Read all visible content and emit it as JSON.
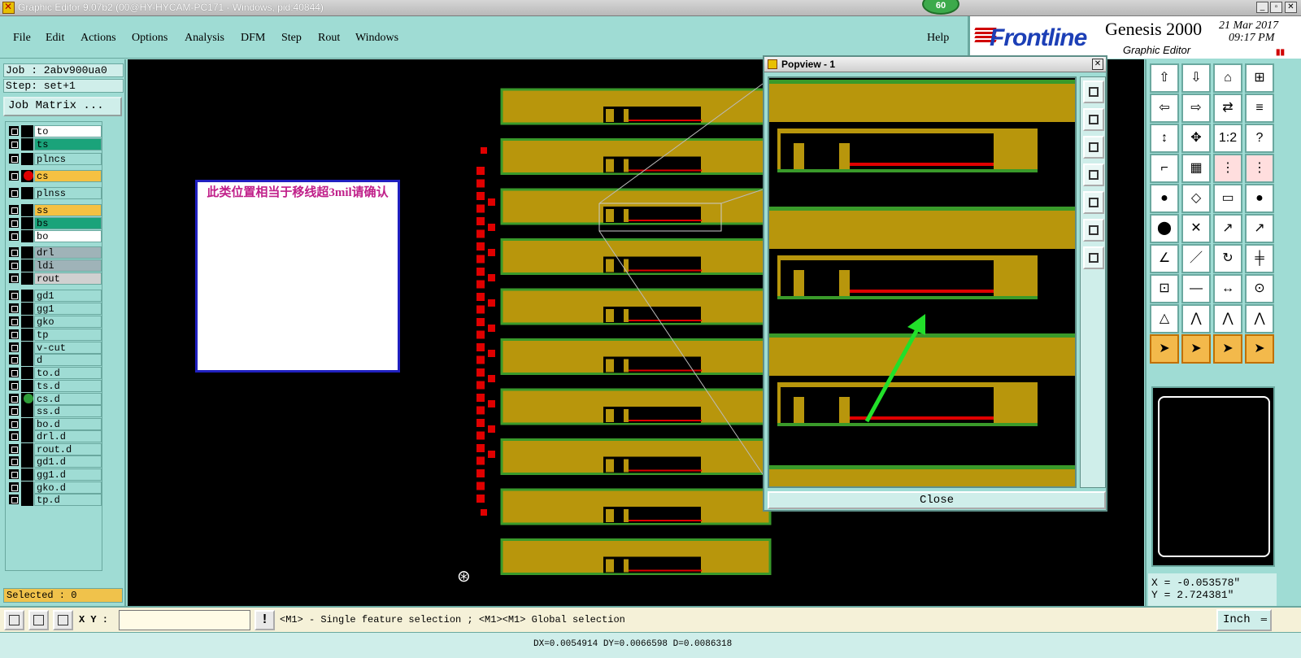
{
  "window": {
    "title": "Graphic Editor 9.07b2 (00@HY-HYCAM-PC171 - Windows, pid:40844)",
    "counter_badge": "60",
    "controls": [
      "_",
      "▫",
      "✕"
    ]
  },
  "menu": {
    "items": [
      "File",
      "Edit",
      "Actions",
      "Options",
      "Analysis",
      "DFM",
      "Step",
      "Rout",
      "Windows"
    ],
    "help": "Help"
  },
  "logo": {
    "brand": "Frontline",
    "product": "Genesis 2000",
    "date": "21 Mar 2017",
    "time": "09:17 PM",
    "subtitle": "Graphic Editor",
    "marks": "▮▮",
    "accent_color": "#1c3fb6"
  },
  "job": {
    "job_label": "Job : 2abv900ua0",
    "step_label": "Step: set+1",
    "matrix_button": "Job Matrix ..."
  },
  "layers": [
    {
      "name": "to",
      "bg": "#ffffff"
    },
    {
      "name": "ts",
      "bg": "#1aa37a"
    },
    {
      "name": "plncs",
      "bg": "#9fdcd4"
    },
    {
      "name": "cs",
      "bg": "#f5c142",
      "active": true,
      "marker": "#e00000"
    },
    {
      "name": "plnss",
      "bg": "#9fdcd4"
    },
    {
      "name": "ss",
      "bg": "#f5c142"
    },
    {
      "name": "bs",
      "bg": "#1aa37a"
    },
    {
      "name": "bo",
      "bg": "#ffffff"
    },
    {
      "name": "drl",
      "bg": "#9fb3b8"
    },
    {
      "name": "ldi",
      "bg": "#9fb3b8"
    },
    {
      "name": "rout",
      "bg": "#d0d0d0"
    },
    {
      "name": "gd1",
      "bg": "#9fdcd4"
    },
    {
      "name": "gg1",
      "bg": "#9fdcd4"
    },
    {
      "name": "gko",
      "bg": "#9fdcd4"
    },
    {
      "name": "tp",
      "bg": "#9fdcd4"
    },
    {
      "name": "v-cut",
      "bg": "#9fdcd4"
    },
    {
      "name": "d",
      "bg": "#9fdcd4"
    },
    {
      "name": "to.d",
      "bg": "#9fdcd4"
    },
    {
      "name": "ts.d",
      "bg": "#9fdcd4"
    },
    {
      "name": "cs.d",
      "bg": "#9fdcd4",
      "marker": "#2f9e3a"
    },
    {
      "name": "ss.d",
      "bg": "#9fdcd4"
    },
    {
      "name": "bo.d",
      "bg": "#9fdcd4"
    },
    {
      "name": "drl.d",
      "bg": "#9fdcd4"
    },
    {
      "name": "rout.d",
      "bg": "#9fdcd4"
    },
    {
      "name": "gd1.d",
      "bg": "#9fdcd4"
    },
    {
      "name": "gg1.d",
      "bg": "#9fdcd4"
    },
    {
      "name": "gko.d",
      "bg": "#9fdcd4"
    },
    {
      "name": "tp.d",
      "bg": "#9fdcd4"
    }
  ],
  "selected": "Selected : 0",
  "note": {
    "text": "此类位置相当于移线超3mil请确认"
  },
  "popview": {
    "title": "Popview - 1",
    "close_label": "Close"
  },
  "coords": {
    "x": "X = -0.053578\"",
    "y": "Y = 2.724381\""
  },
  "command": {
    "xy_label": "X Y :",
    "xy_value": "",
    "message_icon": "!",
    "status": "<M1> - Single feature selection ; <M1><M1> Global selection",
    "units": "Inch"
  },
  "measure": "DX=0.0054914 DY=0.0066598 D=0.0086318",
  "colors": {
    "copper": "#b8960c",
    "soldermask_edge": "#3a9a2a",
    "trace_red": "#e00000",
    "arrow_green": "#22e02a",
    "panel_bg": "#9fdcd4"
  }
}
